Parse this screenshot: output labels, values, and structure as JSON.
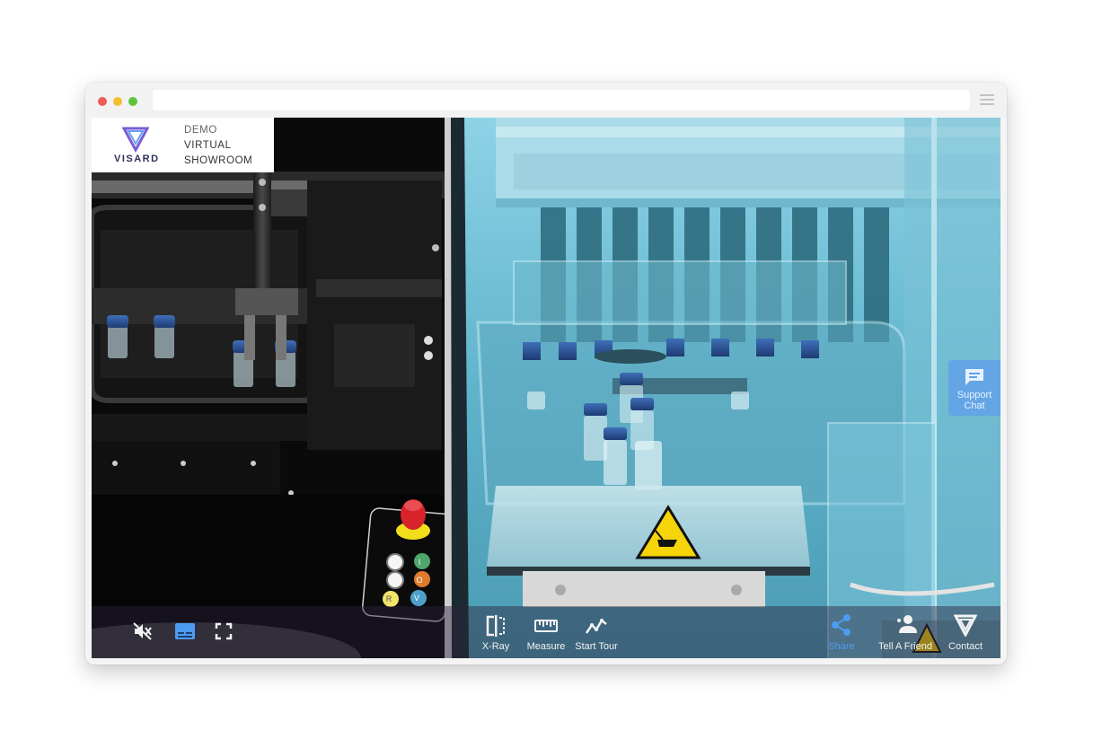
{
  "branding": {
    "logo_word": "VISARD",
    "line1": "DEMO",
    "line2": "VIRTUAL",
    "line3": "SHOWROOM"
  },
  "support": {
    "label_line1": "Support",
    "label_line2": "Chat",
    "icon": "chat-icon"
  },
  "toolbar": {
    "left": [
      {
        "icon": "mute-icon",
        "label": ""
      },
      {
        "icon": "subtitles-icon",
        "label": ""
      },
      {
        "icon": "fullscreen-icon",
        "label": ""
      }
    ],
    "xray_label": "X-Ray",
    "measure_label": "Measure",
    "tour_label": "Start Tour",
    "share_label": "Share",
    "friend_label": "Tell A Friend",
    "contact_label": "Contact"
  },
  "control_panel": {
    "button_letters": [
      "I",
      "O",
      "R",
      "V"
    ]
  },
  "colors": {
    "accent": "#4d9cf2",
    "support_bg": "#61a0e9",
    "emergency_red": "#d8232a",
    "hazard_yellow": "#f6d40a"
  }
}
